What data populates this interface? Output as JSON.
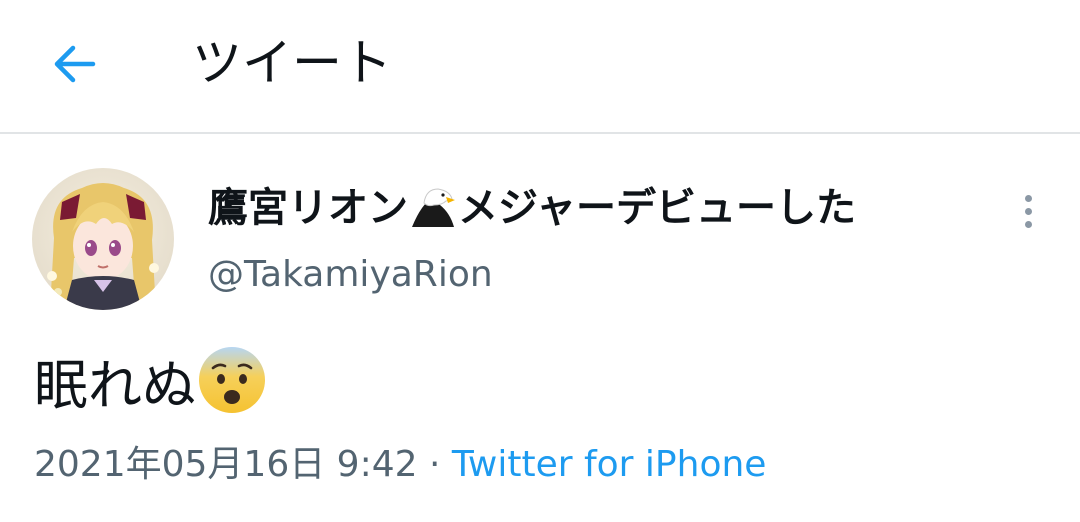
{
  "header": {
    "title": "ツイート",
    "back_icon": "arrow-left-icon"
  },
  "tweet": {
    "author_name_prefix": "鷹宮リオン",
    "author_name_emoji": "eagle-icon",
    "author_name_suffix": "メジャーデビューした",
    "handle": "@TakamiyaRion",
    "text": "眠れぬ",
    "text_emoji": "anxious-face-icon",
    "date": "2021年05月16日 9:42",
    "separator": " · ",
    "source": "Twitter for iPhone"
  },
  "colors": {
    "accent": "#1d9bf0",
    "secondary_text": "#536471",
    "primary_text": "#0f1419",
    "divider": "#e1e4e6"
  }
}
